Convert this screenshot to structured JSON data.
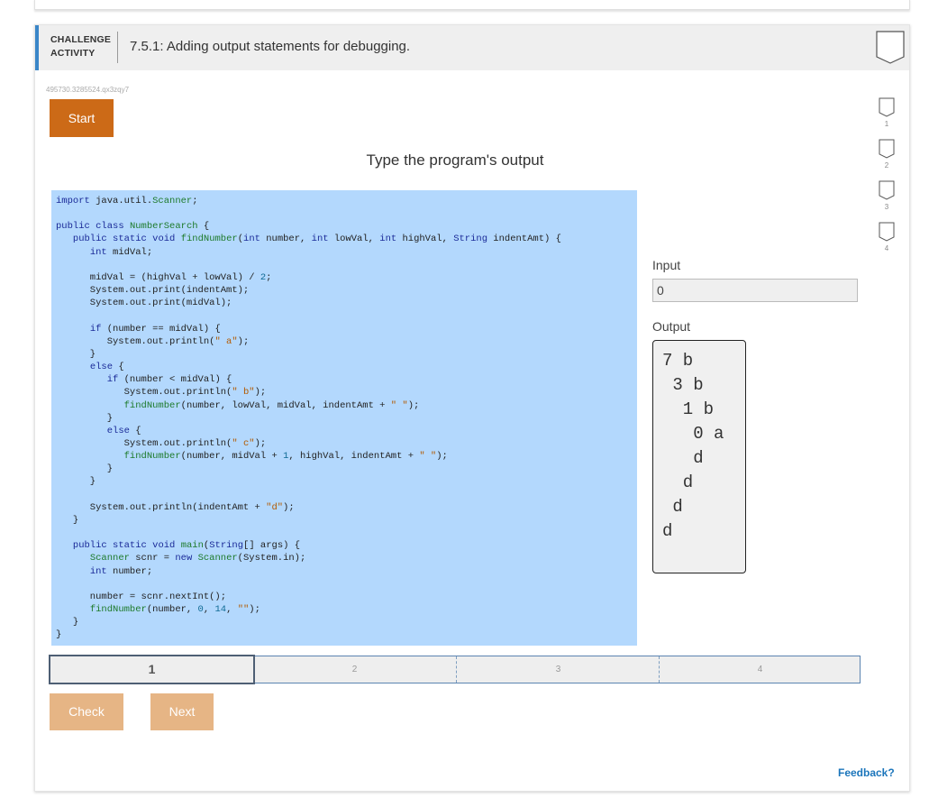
{
  "header": {
    "kind_line1": "CHALLENGE",
    "kind_line2": "ACTIVITY",
    "title": "7.5.1: Adding output statements for debugging."
  },
  "activity_id": "495730.3285524.qx3zqy7",
  "start_label": "Start",
  "instruction": "Type the program's output",
  "code_lines": [
    "import java.util.Scanner;",
    "",
    "public class NumberSearch {",
    "   public static void findNumber(int number, int lowVal, int highVal, String indentAmt) {",
    "      int midVal;",
    "",
    "      midVal = (highVal + lowVal) / 2;",
    "      System.out.print(indentAmt);",
    "      System.out.print(midVal);",
    "",
    "      if (number == midVal) {",
    "         System.out.println(\" a\");",
    "      }",
    "      else {",
    "         if (number < midVal) {",
    "            System.out.println(\" b\");",
    "            findNumber(number, lowVal, midVal, indentAmt + \" \");",
    "         }",
    "         else {",
    "            System.out.println(\" c\");",
    "            findNumber(number, midVal + 1, highVal, indentAmt + \" \");",
    "         }",
    "      }",
    "",
    "      System.out.println(indentAmt + \"d\");",
    "   }",
    "",
    "   public static void main(String[] args) {",
    "      Scanner scnr = new Scanner(System.in);",
    "      int number;",
    "",
    "      number = scnr.nextInt();",
    "      findNumber(number, 0, 14, \"\");",
    "   }",
    "}"
  ],
  "input_label": "Input",
  "input_value": "0",
  "output_label": "Output",
  "output_text": "7 b\n 3 b\n  1 b\n   0 a\n   d\n  d\n d\nd",
  "level_badges": [
    "1",
    "2",
    "3",
    "4"
  ],
  "steps": [
    "1",
    "2",
    "3",
    "4"
  ],
  "active_step": "1",
  "check_label": "Check",
  "next_label": "Next",
  "feedback_label": "Feedback?",
  "colors": {
    "accent_blue": "#3a86c8",
    "start_orange": "#cc6a17",
    "disabled_orange": "#e6b585",
    "code_bg": "#b3d8fd",
    "link_blue": "#1b75bb"
  },
  "icons": {
    "header_badge": "shield-badge-icon",
    "level_badge": "shield-badge-icon"
  }
}
